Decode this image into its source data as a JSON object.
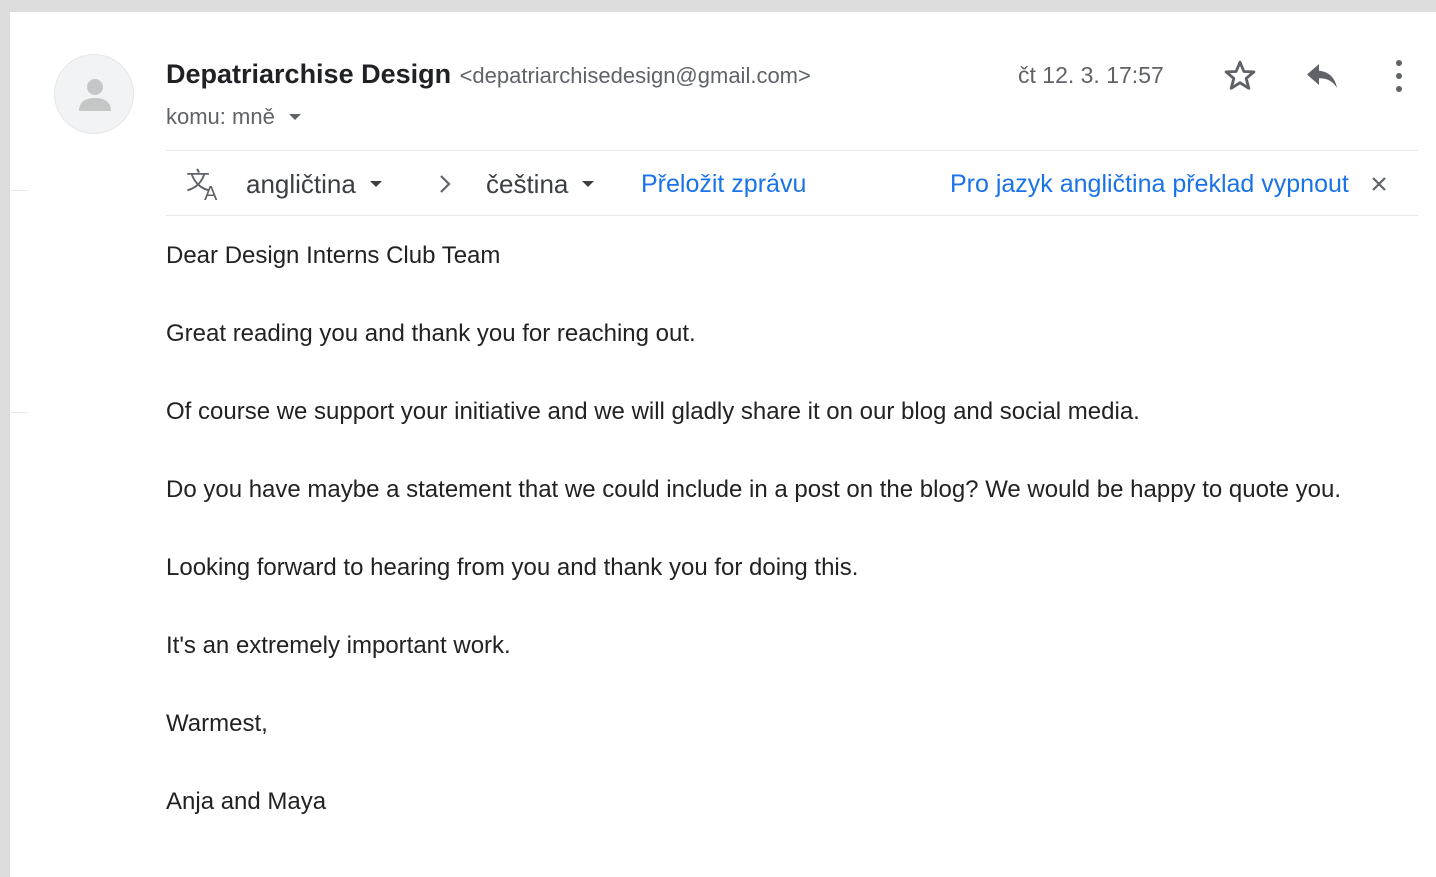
{
  "header": {
    "sender_name": "Depatriarchise Design",
    "sender_email": "<depatriarchisedesign@gmail.com>",
    "recipient": "komu: mně",
    "date": "čt 12. 3. 17:57",
    "icons": [
      "person-icon",
      "star-icon",
      "reply-icon",
      "more-vert-icon",
      "chevron-down-icon"
    ]
  },
  "translate": {
    "source_lang": "angličtina",
    "target_lang": "čeština",
    "translate_link": "Přeložit zprávu",
    "turn_off_link": "Pro jazyk angličtina překlad vypnout",
    "icons": [
      "translate-icon",
      "chevron-right-icon",
      "close-icon"
    ]
  },
  "message": {
    "paragraphs": [
      "Dear Design Interns Club Team",
      "Great reading you and thank you for reaching out.",
      "Of course we support your initiative and we will gladly share it on our blog and social media.",
      "Do you have maybe a statement that we could include in a post on the blog? We would be happy to quote you.",
      "Looking forward to hearing from you and thank you for doing this.",
      "It's an extremely important work.",
      "Warmest,",
      "Anja and Maya"
    ]
  },
  "colors": {
    "link": "#1a73e8",
    "muted": "#5f6368",
    "text": "#222222",
    "background": "#dcdcdc"
  }
}
